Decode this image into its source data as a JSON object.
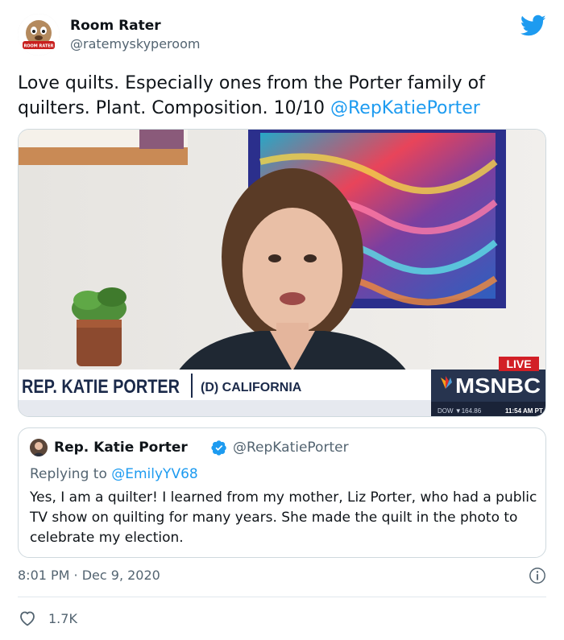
{
  "tweet": {
    "author_name": "Room Rater",
    "author_handle": "@ratemyskyperoom",
    "avatar_badge": "ROOM RATER",
    "text": "Love quilts. Especially ones from the Porter family of quilters. Plant. Composition. 10/10 ",
    "mention": "@RepKatiePorter",
    "timestamp": "8:01 PM · Dec 9, 2020",
    "likes": "1.7K"
  },
  "media": {
    "lower_third_name": "REP. KATIE PORTER",
    "lower_third_detail": "(D) CALIFORNIA",
    "live_badge": "LIVE",
    "network": "MSNBC",
    "ticker_left": "DOW ▼164.86",
    "ticker_time": "11:54 AM PT"
  },
  "quote": {
    "author_name": "Rep. Katie Porter",
    "author_handle": "@RepKatiePorter",
    "replying_prefix": "Replying to ",
    "replying_to": "@EmilyYV68",
    "text": "Yes, I am a quilter! I learned from my mother, Liz Porter, who had a public TV show on quilting for many years. She made the quilt in the photo to celebrate my election."
  },
  "colors": {
    "link": "#1d9bf0",
    "secondary_text": "#536471",
    "verified": "#1d9bf0"
  },
  "icons": {
    "brand": "twitter-bird-icon",
    "verified": "verified-badge-icon",
    "info": "info-icon",
    "like": "heart-icon"
  }
}
